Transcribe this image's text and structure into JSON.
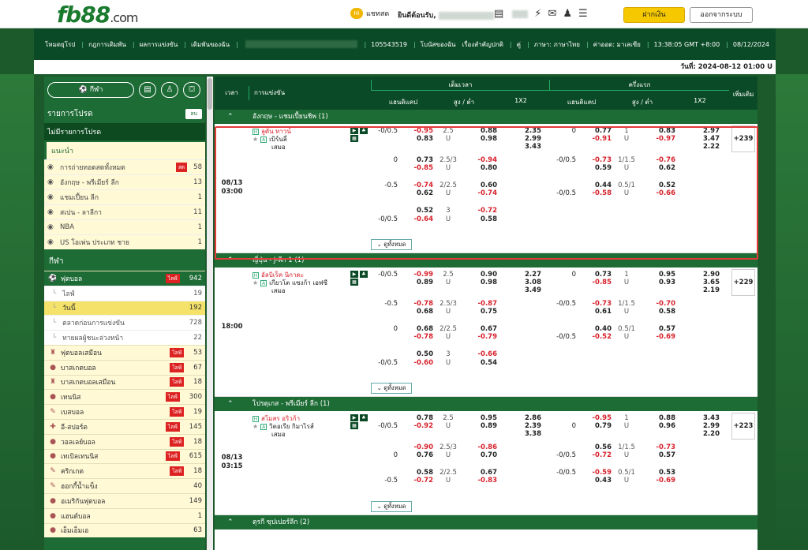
{
  "header": {
    "logo": "fb88",
    "logo_suffix": ".com",
    "chat_label": "แชทสด",
    "welcome": "ยินดีต้อนรับ,",
    "deposit": "ฝากเงิน",
    "logout": "ออกจากระบบ"
  },
  "nav": {
    "items": [
      "โหมดยุโรป",
      "กฎการเดิมพัน",
      "ผลการแข่งขัน",
      "เดิมพันของฉัน"
    ],
    "account": "105543519",
    "promo": "โบนัสของฉัน",
    "favorites": "เรื่องสำคัญปกติ",
    "pair": "คู่",
    "language": "ภาษา: ภาษาไทย",
    "odds": "ค่าออด: มาเลเซีย",
    "time": "13:38:05 GMT +8:00",
    "date": "08/12/2024"
  },
  "datebar": "วันที่: 2024-08-12 01:00 U",
  "sidebar": {
    "sports_button": "กีฬา",
    "fav_title": "รายการโปรด",
    "edit": "ลบ",
    "no_fav": "ไม่มีรายการโปรด",
    "rec_title": "แนะนำ",
    "rec": [
      {
        "icon": "broadcast-icon",
        "name": "การถ่ายทอดสดทั้งหมด",
        "live": "สด",
        "count": "58"
      },
      {
        "icon": "england-icon",
        "name": "อังกฤษ - พรีเมียร์ ลีก",
        "count": "13"
      },
      {
        "icon": "globe-icon",
        "name": "แชมเปี้ยน ลีก",
        "count": "1"
      },
      {
        "icon": "spain-icon",
        "name": "สเปน - ลาลีกา",
        "count": "11"
      },
      {
        "icon": "nba-icon",
        "name": "NBA",
        "count": "1"
      },
      {
        "icon": "usa-icon",
        "name": "US โอเพ่น ประเภท ชาย",
        "count": "1"
      }
    ],
    "sports_title": "กีฬา",
    "football": {
      "name": "ฟุตบอล",
      "live": "ไลฟ์",
      "count": "942"
    },
    "sub": [
      {
        "name": "ไลฟ์",
        "count": "19"
      },
      {
        "name": "วันนี้",
        "count": "192"
      },
      {
        "name": "ตลาดก่อนการแข่งขัน",
        "count": "728"
      },
      {
        "name": "ทายผลผู้ชนะล่วงหน้า",
        "count": "22"
      }
    ],
    "sports": [
      {
        "icon": "futsal-icon",
        "glyph": "♜",
        "name": "ฟุตบอลเสมือน",
        "live": "ไลฟ์",
        "count": "53"
      },
      {
        "icon": "basketball-icon",
        "glyph": "●",
        "name": "บาสเกตบอล",
        "live": "ไลฟ์",
        "count": "67"
      },
      {
        "icon": "vbasket-icon",
        "glyph": "♜",
        "name": "บาสเกตบอลเสมือน",
        "live": "ไลฟ์",
        "count": "18"
      },
      {
        "icon": "tennis-icon",
        "glyph": "●",
        "name": "เทนนิส",
        "live": "ไลฟ์",
        "count": "300"
      },
      {
        "icon": "baseball-icon",
        "glyph": "✎",
        "name": "เบสบอล",
        "live": "ไลฟ์",
        "count": "19"
      },
      {
        "icon": "esports-icon",
        "glyph": "✚",
        "name": "อี-สปอร์ต",
        "live": "ไลฟ์",
        "count": "145"
      },
      {
        "icon": "volleyball-icon",
        "glyph": "●",
        "name": "วอลเลย์บอล",
        "live": "ไลฟ์",
        "count": "18"
      },
      {
        "icon": "tabletennis-icon",
        "glyph": "●",
        "name": "เทเบิลเทนนิส",
        "live": "ไลฟ์",
        "count": "615"
      },
      {
        "icon": "cricket-icon",
        "glyph": "✎",
        "name": "คริกเกต",
        "live": "ไลฟ์",
        "count": "18"
      },
      {
        "icon": "hockey-icon",
        "glyph": "✎",
        "name": "ฮอกกี้น้ำแข็ง",
        "count": "40"
      },
      {
        "icon": "americanfootball-icon",
        "glyph": "●",
        "name": "อเมริกันฟุตบอล",
        "count": "149"
      },
      {
        "icon": "handball-icon",
        "glyph": "●",
        "name": "แฮนด์บอล",
        "count": "1"
      },
      {
        "icon": "badminton-icon",
        "glyph": "●",
        "name": "เอ็มเอ็มเอ",
        "count": "63"
      }
    ]
  },
  "table": {
    "time": "เวลา",
    "match": "การแข่งขัน",
    "ft": "เต็มเวลา",
    "ht": "ครึ่งแรก",
    "hdp": "แฮนดิแคป",
    "ou": "สูง / ต่ำ",
    "x12": "1X2",
    "more": "เพิ่มเติม",
    "more_btn": "ดูทั้งหมด"
  },
  "leagues": [
    {
      "name": "อังกฤษ - แชมเปี้ยนชิพ (1)",
      "time": "08/13\n03:00",
      "home": "ลูตัน ทาวน์",
      "away": "เบิร์นลี่",
      "draw": "เสมอ",
      "plus": "+239",
      "rows": [
        [
          "-0/0.5",
          "-0.95",
          "2.5",
          "0.88",
          "2.35",
          "0",
          "0.77",
          "1",
          "0.83",
          "2.97"
        ],
        [
          "",
          "0.83",
          "U",
          "0.98",
          "2.99",
          "",
          "-0.91",
          "U",
          "-0.97",
          "3.47"
        ],
        [
          "",
          "",
          "",
          "",
          "3.43",
          "",
          "",
          "",
          "",
          "2.22"
        ],
        [
          "0",
          "0.73",
          "2.5/3",
          "-0.94",
          "",
          "-0/0.5",
          "-0.73",
          "1/1.5",
          "-0.76",
          ""
        ],
        [
          "",
          "-0.85",
          "U",
          "0.80",
          "",
          "",
          "0.59",
          "U",
          "0.62",
          ""
        ],
        [
          "-0.5",
          "-0.74",
          "2/2.5",
          "0.60",
          "",
          "",
          "0.44",
          "0.5/1",
          "0.52",
          ""
        ],
        [
          "",
          "0.62",
          "U",
          "-0.74",
          "",
          "-0/0.5",
          "-0.58",
          "U",
          "-0.66",
          ""
        ],
        [
          "",
          "0.52",
          "3",
          "-0.72",
          "",
          "",
          "",
          "",
          "",
          ""
        ],
        [
          "-0/0.5",
          "-0.64",
          "U",
          "0.58",
          "",
          "",
          "",
          "",
          "",
          ""
        ]
      ]
    },
    {
      "name": "ญี่ปุ่น - J-ลีก 1 (1)",
      "time": "18:00",
      "home": "อัลบิเร็ค นิกาตะ",
      "away": "เกียวโต แซงก้า เอฟซี",
      "draw": "เสมอ",
      "plus": "+229",
      "rows": [
        [
          "-0/0.5",
          "-0.99",
          "2.5",
          "0.90",
          "2.27",
          "0",
          "0.73",
          "1",
          "0.95",
          "2.90"
        ],
        [
          "",
          "0.89",
          "U",
          "0.98",
          "3.08",
          "",
          "-0.85",
          "U",
          "0.93",
          "3.65"
        ],
        [
          "",
          "",
          "",
          "",
          "3.49",
          "",
          "",
          "",
          "",
          "2.19"
        ],
        [
          "-0.5",
          "-0.78",
          "2.5/3",
          "-0.87",
          "",
          "-0/0.5",
          "-0.73",
          "1/1.5",
          "-0.70",
          ""
        ],
        [
          "",
          "0.68",
          "U",
          "0.75",
          "",
          "",
          "0.61",
          "U",
          "0.58",
          ""
        ],
        [
          "0",
          "0.68",
          "2/2.5",
          "0.67",
          "",
          "",
          "0.40",
          "0.5/1",
          "0.57",
          ""
        ],
        [
          "",
          "-0.78",
          "U",
          "-0.79",
          "",
          "-0/0.5",
          "-0.52",
          "U",
          "-0.69",
          ""
        ],
        [
          "",
          "0.50",
          "3",
          "-0.66",
          "",
          "",
          "",
          "",
          "",
          ""
        ],
        [
          "-0/0.5",
          "-0.60",
          "U",
          "0.54",
          "",
          "",
          "",
          "",
          "",
          ""
        ]
      ]
    },
    {
      "name": "โปรตุเกส - พรีเมียร์ ลีก (1)",
      "time": "08/13\n03:15",
      "home": "สโมสร อริวก้า",
      "away": "วิตอเรีย กิมาไรส์",
      "draw": "เสมอ",
      "plus": "+223",
      "rows": [
        [
          "",
          "0.78",
          "2.5",
          "0.95",
          "2.86",
          "",
          "-0.95",
          "1",
          "0.88",
          "3.43"
        ],
        [
          "-0/0.5",
          "-0.92",
          "U",
          "0.89",
          "2.39",
          "0",
          "0.79",
          "U",
          "0.96",
          "2.99"
        ],
        [
          "",
          "",
          "",
          "",
          "3.38",
          "",
          "",
          "",
          "",
          "2.20"
        ],
        [
          "",
          "-0.90",
          "2.5/3",
          "-0.86",
          "",
          "",
          "0.56",
          "1/1.5",
          "-0.73",
          ""
        ],
        [
          "0",
          "0.76",
          "U",
          "0.70",
          "",
          "-0/0.5",
          "-0.72",
          "U",
          "0.57",
          ""
        ],
        [
          "",
          "0.58",
          "2/2.5",
          "0.67",
          "",
          "-0/0.5",
          "-0.59",
          "0.5/1",
          "0.53",
          ""
        ],
        [
          "-0.5",
          "-0.72",
          "U",
          "-0.83",
          "",
          "",
          "0.43",
          "U",
          "-0.69",
          ""
        ]
      ]
    },
    {
      "name": "ตุรกี ซุปเปอร์ลีก (2)"
    }
  ]
}
